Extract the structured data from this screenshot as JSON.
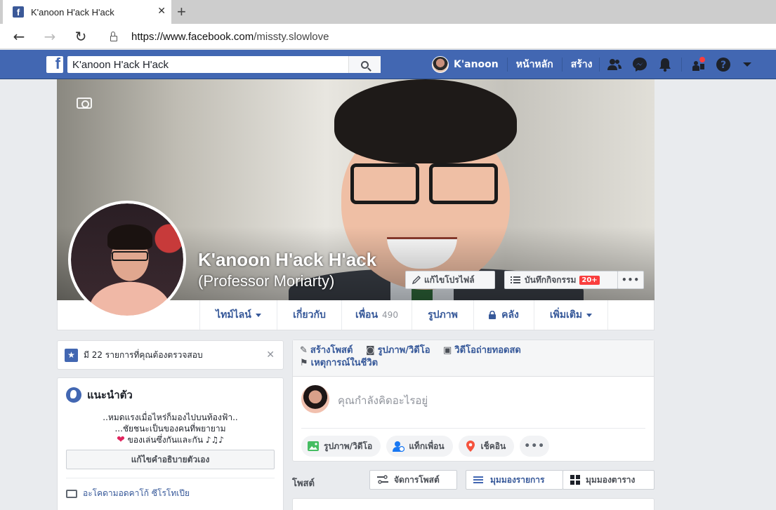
{
  "browser": {
    "tab_title": "K'anoon H'ack H'ack",
    "url_prefix": "https://www.facebook.com",
    "url_path": "/missty.slowlove"
  },
  "fb_header": {
    "search_value": "K'anoon H'ack H'ack",
    "user_name": "K'anoon",
    "home_label": "หน้าหลัก",
    "create_label": "สร้าง"
  },
  "profile": {
    "name": "K'anoon H'ack H'ack",
    "alternate_name": "(Professor Moriarty)",
    "edit_profile_label": "แก้ไขโปรไฟล์",
    "activity_log_label": "บันทึกกิจกรรม",
    "activity_badge": "20+"
  },
  "tabs": {
    "timeline": "ไทม์ไลน์",
    "about": "เกี่ยวกับ",
    "friends": "เพื่อน",
    "friends_count": "490",
    "photos": "รูปภาพ",
    "archive": "คลัง",
    "more": "เพิ่มเติม"
  },
  "review_notice": "มี 22 รายการที่คุณต้องตรวจสอบ",
  "intro": {
    "title": "แนะนำตัว",
    "bio_line1": "..หมดแรงเมื่อไหร่ก็มองไปบนท้องฟ้า..",
    "bio_line2": "...ชัยชนะเป็นของคนที่พยายาม",
    "bio_line3": "ของเล่นซึ่งกันและกัน ♪♫♪",
    "edit_bio_label": "แก้ไขคำอธิบายตัวเอง",
    "work_line": "อะโคดามอดคาโก้ ซีโรโทเปีย"
  },
  "composer": {
    "create_post": "สร้างโพสต์",
    "photo_video": "รูปภาพ/วิดีโอ",
    "live_video": "วิดีโอถ่ายทอดสด",
    "life_event": "เหตุการณ์ในชีวิต",
    "placeholder": "คุณกำลังคิดอะไรอยู่",
    "action_photo": "รูปภาพ/วิดีโอ",
    "action_tag": "แท็กเพื่อน",
    "action_checkin": "เช็คอิน",
    "action_more": "•••"
  },
  "posts_bar": {
    "label": "โพสต์",
    "manage": "จัดการโพสต์",
    "list_view": "มุมมองรายการ",
    "grid_view": "มุมมองตาราง"
  },
  "colors": {
    "fb_blue": "#4267b2",
    "link_blue": "#365899",
    "notif_red": "#fa3e3e"
  }
}
